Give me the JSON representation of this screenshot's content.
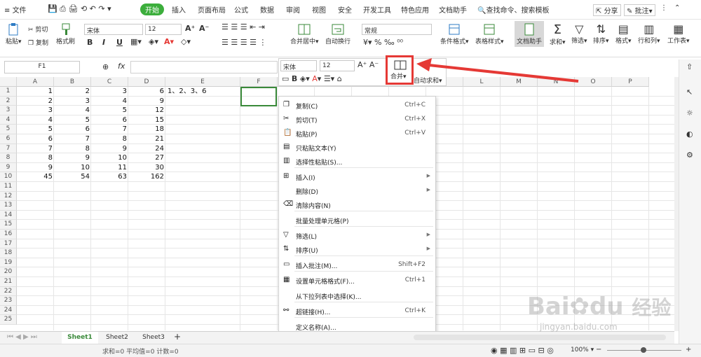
{
  "menubar": {
    "file": "文件",
    "tabs": [
      "开始",
      "插入",
      "页面布局",
      "公式",
      "数据",
      "审阅",
      "视图",
      "安全",
      "开发工具",
      "特色应用",
      "文档助手"
    ],
    "search": "查找命令、搜索模板",
    "share": "分享",
    "comment": "批注"
  },
  "ribbon": {
    "paste": "粘贴",
    "cut": "剪切",
    "copy": "复制",
    "format_painter": "格式刷",
    "font": "宋体",
    "size": "12",
    "bold": "B",
    "italic": "I",
    "underline": "U",
    "merge_center": "合并居中",
    "wrap": "自动换行",
    "number_format": "常规",
    "cond_format": "条件格式",
    "table_style": "表格样式",
    "doc_helper": "文档助手",
    "sum": "求和",
    "filter": "筛选",
    "sort": "排序",
    "format": "格式",
    "rowcol": "行和列",
    "worksheet": "工作表"
  },
  "formulabar": {
    "namebox": "F1",
    "fx": "fx"
  },
  "columns": [
    "A",
    "B",
    "C",
    "D",
    "E",
    "F",
    "G",
    "H",
    "I",
    "J",
    "K",
    "L",
    "M",
    "N",
    "O",
    "P"
  ],
  "rows": [
    [
      "1",
      "2",
      "3",
      "6",
      "1、2、3、6"
    ],
    [
      "2",
      "3",
      "4",
      "9",
      ""
    ],
    [
      "3",
      "4",
      "5",
      "12",
      ""
    ],
    [
      "4",
      "5",
      "6",
      "15",
      ""
    ],
    [
      "5",
      "6",
      "7",
      "18",
      ""
    ],
    [
      "6",
      "7",
      "8",
      "21",
      ""
    ],
    [
      "7",
      "8",
      "9",
      "24",
      ""
    ],
    [
      "8",
      "9",
      "10",
      "27",
      ""
    ],
    [
      "9",
      "10",
      "11",
      "30",
      ""
    ],
    [
      "45",
      "54",
      "63",
      "162",
      ""
    ]
  ],
  "row_numbers": [
    "1",
    "2",
    "3",
    "4",
    "5",
    "6",
    "7",
    "8",
    "9",
    "10",
    "11",
    "12",
    "13",
    "14",
    "15",
    "16",
    "17",
    "18",
    "19",
    "20",
    "21",
    "22",
    "23",
    "24",
    "25"
  ],
  "minitoolbar": {
    "font": "宋体",
    "size": "12",
    "merge": "合并",
    "autosum": "自动求和"
  },
  "context_menu": [
    {
      "label": "复制(C)",
      "shortcut": "Ctrl+C",
      "icon": "copy-icon"
    },
    {
      "label": "剪切(T)",
      "shortcut": "Ctrl+X",
      "icon": "scissors-icon"
    },
    {
      "label": "粘贴(P)",
      "shortcut": "Ctrl+V",
      "icon": "paste-icon"
    },
    {
      "label": "只粘贴文本(Y)",
      "shortcut": "",
      "icon": "paste-text-icon"
    },
    {
      "label": "选择性粘贴(S)...",
      "shortcut": "",
      "icon": "paste-special-icon"
    },
    {
      "label": "插入(I)",
      "shortcut": "",
      "icon": "insert-icon",
      "submenu": true
    },
    {
      "label": "删除(D)",
      "shortcut": "",
      "icon": "",
      "submenu": true
    },
    {
      "label": "清除内容(N)",
      "shortcut": "",
      "icon": "eraser-icon"
    },
    {
      "label": "批量处理单元格(P)",
      "shortcut": "",
      "icon": ""
    },
    {
      "label": "筛选(L)",
      "shortcut": "",
      "icon": "filter-icon",
      "submenu": true
    },
    {
      "label": "排序(U)",
      "shortcut": "",
      "icon": "sort-icon",
      "submenu": true
    },
    {
      "label": "插入批注(M)...",
      "shortcut": "Shift+F2",
      "icon": "comment-icon"
    },
    {
      "label": "设置单元格格式(F)...",
      "shortcut": "Ctrl+1",
      "icon": "format-cells-icon"
    },
    {
      "label": "从下拉列表中选择(K)...",
      "shortcut": "",
      "icon": ""
    },
    {
      "label": "超链接(H)...",
      "shortcut": "Ctrl+K",
      "icon": "link-icon"
    },
    {
      "label": "定义名称(A)...",
      "shortcut": "",
      "icon": ""
    }
  ],
  "sheets": [
    "Sheet1",
    "Sheet2",
    "Sheet3"
  ],
  "status": {
    "sum": "求和=0",
    "avg": "平均值=0",
    "count": "计数=0",
    "zoom": "100%"
  },
  "watermark": {
    "brand": "Bai",
    "suffix": "经验",
    "url": "jingyan.baidu.com"
  },
  "colors": {
    "accent": "#3cae3c",
    "highlight": "#e53935",
    "arrow": "#e53935"
  }
}
